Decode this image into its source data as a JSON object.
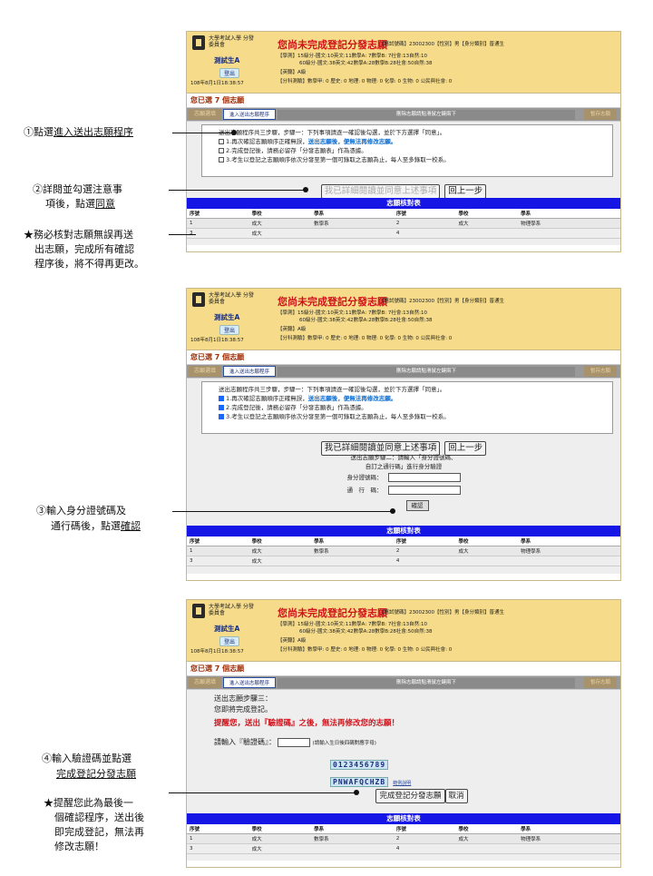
{
  "header": {
    "org": "大學考試入學 分發委員會",
    "user": "測試生A",
    "logout": "登出",
    "timestamp": "108年8月1日18:38:57",
    "title": "您尚未完成登記分發志願",
    "info": "【應試號碼】23002300【性別】男【身分類別】普通生",
    "line1": "【學測】15級分-國文:10英文:11數學A: 7數學B: 7社會:13自然:10",
    "line2": "60級分-國文:38英文:42數學A:28數學B:28社會:50自然:38",
    "line3": "【英聽】A級",
    "line4": "【分科測驗】數學甲: 0 歷史: 0 地理: 0 物理: 0 化學: 0 生物: 0 公民與社會: 0"
  },
  "selected": "您已選 7 個志願",
  "tabs": {
    "tab1": "志願選填",
    "tab2": "進入送出志願程序",
    "mid": "刪除志願請點滑鼠左鍵兩下",
    "tab3": "暫存志願"
  },
  "terms": {
    "intro": "送出志願程序共三步驟，步驟一：下列事項請逐一確認後勾選，並於下方選擇「同意」。",
    "i1a": "1.再次確認志願順序正確無誤，",
    "i1b": "送出志願後，便無法再修改志願。",
    "i2": "2.完成登記後，請務必留存「分發志願表」作為憑據。",
    "i3": "3.考生以登記之志願順序依次分發至第一個可錄取之志願為止，每人至多錄取一校系。"
  },
  "buttons": {
    "agree": "我已詳細閱讀並同意上述事項",
    "back": "回上一步",
    "confirm": "確認",
    "finish": "完成登記分發志願",
    "cancel": "取消"
  },
  "step2": {
    "t1": "送出志願步驟二：請輸入「身分證號碼、",
    "t2": "自訂之通行碼」進行身分驗證",
    "id_label": "身分證號碼：",
    "pw_label": "通　行　碼："
  },
  "step3": {
    "t1": "送出志願步驟三：",
    "t2": "您即將完成登記。",
    "warn": "提醒您，送出『驗證碼』之後，無法再修改您的志願！",
    "label": "請輸入『驗證碼』：",
    "hint": "(請輸入生日後四碼對應字母)",
    "digits": "0123456789",
    "letters": "PNWAFQCHZB",
    "help": "範例說明"
  },
  "table": {
    "caption": "志願核對表",
    "headers": [
      "序號",
      "學校",
      "學系",
      "序號",
      "學校",
      "學系"
    ],
    "row1": [
      "1",
      "成大",
      "數學系",
      "2",
      "成大",
      "物理學系"
    ],
    "row2": [
      "3",
      "成大",
      "",
      "4",
      "",
      ""
    ]
  },
  "annotations": {
    "a1_pre": "①點選",
    "a1_u": "進入送出志願程序",
    "a2_l1": "②詳閱並勾選注意事",
    "a2_l2_pre": "項後，點選",
    "a2_l2_u": "同意",
    "a_star1_l1": "★務必核對志願無誤再送",
    "a_star1_l2": "出志願，完成所有確認",
    "a_star1_l3": "程序後，將不得再更改。",
    "a3_l1": "③輸入身分證號碼及",
    "a3_l2_pre": "通行碼後，點選",
    "a3_l2_u": "確認",
    "a4_l1": "④輸入驗證碼並點選",
    "a4_l2_u": "完成登記分發志願",
    "a_star2_l1": "★提醒您此為最後一",
    "a_star2_l2": "個確認程序，送出後",
    "a_star2_l3": "即完成登記，無法再",
    "a_star2_l4": "修改志願！"
  }
}
